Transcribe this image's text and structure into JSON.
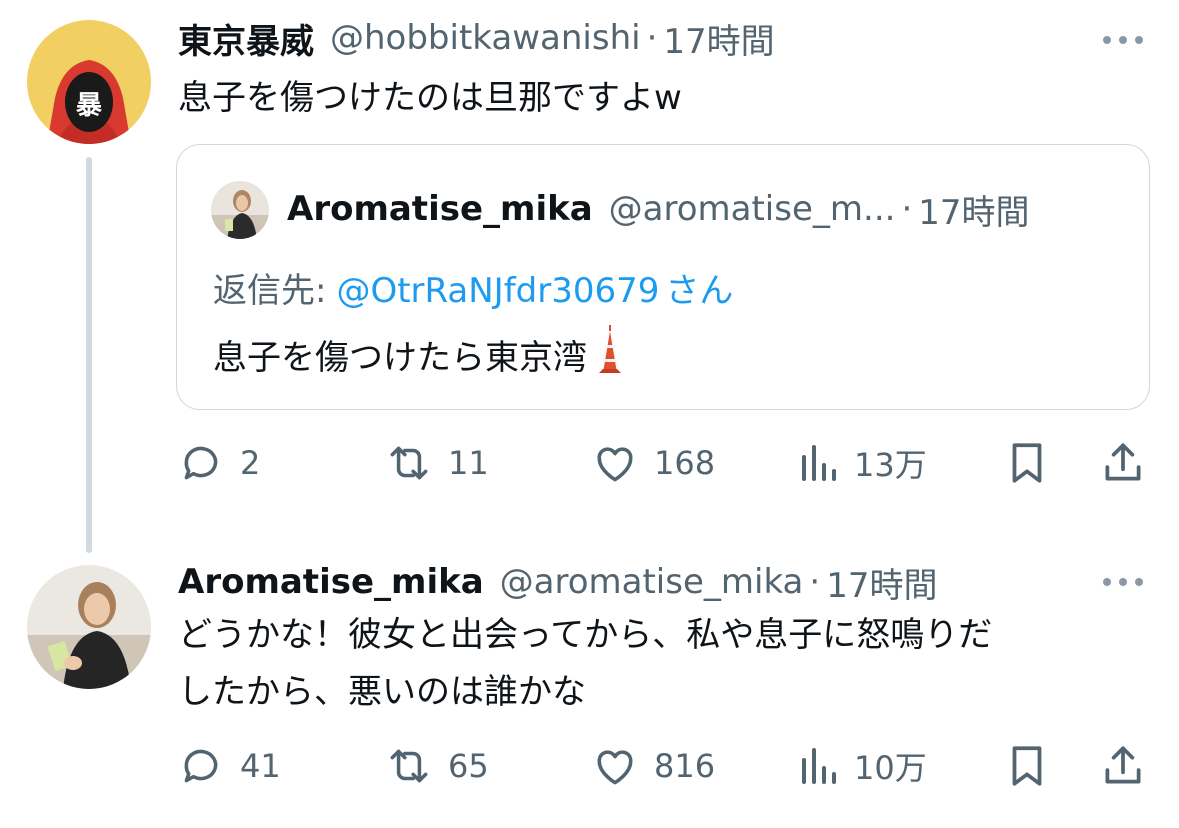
{
  "tweets": [
    {
      "author": "東京暴威",
      "handle": "@hobbitkawanishi",
      "separator": "·",
      "time": "17時間",
      "avatar_glyph": "暴",
      "text": "息子を傷つけたのは旦那ですよw",
      "quote": {
        "author": "Aromatise_mika",
        "handle": "@aromatise_m...",
        "separator": "·",
        "time": "17時間",
        "reply_prefix": "返信先:",
        "reply_mention": "@OtrRaNJfdr30679",
        "reply_suffix": "さん",
        "text": "息子を傷つけたら東京湾",
        "emoji_icon": "tokyo-tower-icon"
      },
      "actions": {
        "replies": "2",
        "retweets": "11",
        "likes": "168",
        "views": "13万"
      }
    },
    {
      "author": "Aromatise_mika",
      "handle": "@aromatise_mika",
      "separator": "·",
      "time": "17時間",
      "text_line1": "どうかな！彼女と出会ってから、私や息子に怒鳴りだ",
      "text_line2": "したから、悪いのは誰かな",
      "actions": {
        "replies": "41",
        "retweets": "65",
        "likes": "816",
        "views": "10万"
      }
    }
  ],
  "colors": {
    "text": "#0f1419",
    "secondary": "#536471",
    "link": "#1d9bf0",
    "border": "#cfd9de",
    "icon": "#536471"
  },
  "icons": [
    "reply-icon",
    "retweet-icon",
    "like-icon",
    "views-icon",
    "bookmark-icon",
    "share-icon",
    "more-icon"
  ]
}
